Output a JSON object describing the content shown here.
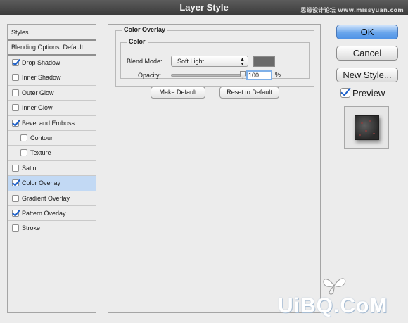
{
  "window": {
    "title": "Layer Style",
    "watermark_site": "思缘设计论坛 www.missyuan.com"
  },
  "style_list": {
    "header_styles": "Styles",
    "header_blending": "Blending Options: Default",
    "items": [
      {
        "label": "Drop Shadow",
        "checked": true,
        "selected": false,
        "indent": false
      },
      {
        "label": "Inner Shadow",
        "checked": false,
        "selected": false,
        "indent": false
      },
      {
        "label": "Outer Glow",
        "checked": false,
        "selected": false,
        "indent": false
      },
      {
        "label": "Inner Glow",
        "checked": false,
        "selected": false,
        "indent": false
      },
      {
        "label": "Bevel and Emboss",
        "checked": true,
        "selected": false,
        "indent": false
      },
      {
        "label": "Contour",
        "checked": false,
        "selected": false,
        "indent": true
      },
      {
        "label": "Texture",
        "checked": false,
        "selected": false,
        "indent": true
      },
      {
        "label": "Satin",
        "checked": false,
        "selected": false,
        "indent": false
      },
      {
        "label": "Color Overlay",
        "checked": true,
        "selected": true,
        "indent": false
      },
      {
        "label": "Gradient Overlay",
        "checked": false,
        "selected": false,
        "indent": false
      },
      {
        "label": "Pattern Overlay",
        "checked": true,
        "selected": false,
        "indent": false
      },
      {
        "label": "Stroke",
        "checked": false,
        "selected": false,
        "indent": false
      }
    ]
  },
  "panel": {
    "section_title": "Color Overlay",
    "group_title": "Color",
    "blend_mode_label": "Blend Mode:",
    "blend_mode_value": "Soft Light",
    "overlay_color": "#6a6a6a",
    "opacity_label": "Opacity:",
    "opacity_value": "100",
    "opacity_unit": "%",
    "opacity_fraction": 1.0,
    "make_default": "Make Default",
    "reset_default": "Reset to Default"
  },
  "actions": {
    "ok": "OK",
    "cancel": "Cancel",
    "new_style": "New Style...",
    "preview_label": "Preview",
    "preview_checked": true
  },
  "watermark_bottom": "UiBQ.CoM",
  "colors": {
    "accent": "#4f93e6",
    "selection": "#c2d9f4",
    "titlebar": "#3a3a3a"
  }
}
